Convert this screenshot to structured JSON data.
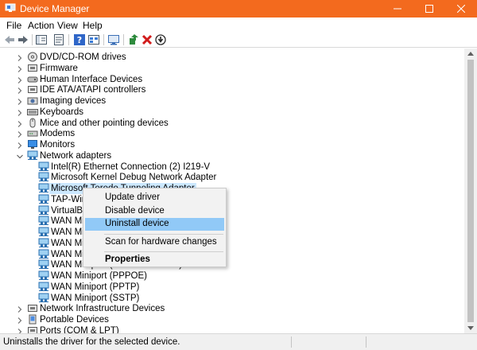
{
  "window": {
    "title": "Device Manager",
    "titlebar_color": "#f36a1e",
    "selection_color": "#cce8ff",
    "menu_hover_color": "#91c9f7"
  },
  "menu": [
    "File",
    "Action",
    "View",
    "Help"
  ],
  "toolbar": {
    "buttons": [
      "back-icon",
      "forward-icon",
      "show-hide-console-tree-icon",
      "properties-icon",
      "help-icon",
      "view-icon",
      "scan-hardware-icon",
      "update-driver-icon",
      "uninstall-icon",
      "disable-device-icon"
    ]
  },
  "tree": {
    "items": [
      {
        "label": "DVD/CD-ROM drives",
        "icon": "dvd-drive-icon",
        "expanded": false
      },
      {
        "label": "Firmware",
        "icon": "firmware-icon",
        "expanded": false
      },
      {
        "label": "Human Interface Devices",
        "icon": "hid-icon",
        "expanded": false
      },
      {
        "label": "IDE ATA/ATAPI controllers",
        "icon": "ide-controller-icon",
        "expanded": false
      },
      {
        "label": "Imaging devices",
        "icon": "camera-icon",
        "expanded": false
      },
      {
        "label": "Keyboards",
        "icon": "keyboard-icon",
        "expanded": false
      },
      {
        "label": "Mice and other pointing devices",
        "icon": "mouse-icon",
        "expanded": false
      },
      {
        "label": "Modems",
        "icon": "modem-icon",
        "expanded": false
      },
      {
        "label": "Monitors",
        "icon": "monitor-icon",
        "expanded": false
      },
      {
        "label": "Network adapters",
        "icon": "network-adapter-icon",
        "expanded": true
      },
      {
        "label": "Intel(R) Ethernet Connection (2) I219-V",
        "icon": "network-adapter-icon",
        "child": true
      },
      {
        "label": "Microsoft Kernel Debug Network Adapter",
        "icon": "network-adapter-icon",
        "child": true
      },
      {
        "label": "Microsoft Teredo Tunneling Adapter",
        "icon": "network-adapter-icon",
        "child": true,
        "selected": true
      },
      {
        "label": "TAP-Windows Adapter V9",
        "icon": "network-adapter-icon",
        "child": true
      },
      {
        "label": "VirtualBox Host-Only Ethernet Adapter",
        "icon": "network-adapter-icon",
        "child": true
      },
      {
        "label": "WAN Miniport (IKEv2)",
        "icon": "network-adapter-icon",
        "child": true
      },
      {
        "label": "WAN Miniport (IP)",
        "icon": "network-adapter-icon",
        "child": true
      },
      {
        "label": "WAN Miniport (IPv6)",
        "icon": "network-adapter-icon",
        "child": true
      },
      {
        "label": "WAN Miniport (L2TP)",
        "icon": "network-adapter-icon",
        "child": true
      },
      {
        "label": "WAN Miniport (Network Monitor)",
        "icon": "network-adapter-icon",
        "child": true
      },
      {
        "label": "WAN Miniport (PPPOE)",
        "icon": "network-adapter-icon",
        "child": true
      },
      {
        "label": "WAN Miniport (PPTP)",
        "icon": "network-adapter-icon",
        "child": true
      },
      {
        "label": "WAN Miniport (SSTP)",
        "icon": "network-adapter-icon",
        "child": true
      },
      {
        "label": "Network Infrastructure Devices",
        "icon": "network-infra-icon",
        "expanded": false
      },
      {
        "label": "Portable Devices",
        "icon": "portable-device-icon",
        "expanded": false
      },
      {
        "label": "Ports (COM & LPT)",
        "icon": "port-icon",
        "expanded": false
      }
    ]
  },
  "context_menu": {
    "items": [
      {
        "label": "Update driver"
      },
      {
        "label": "Disable device"
      },
      {
        "label": "Uninstall device",
        "highlighted": true
      },
      {
        "label": "Scan for hardware changes"
      },
      {
        "label": "Properties",
        "bold": true
      }
    ]
  },
  "status": {
    "text": "Uninstalls the driver for the selected device."
  }
}
